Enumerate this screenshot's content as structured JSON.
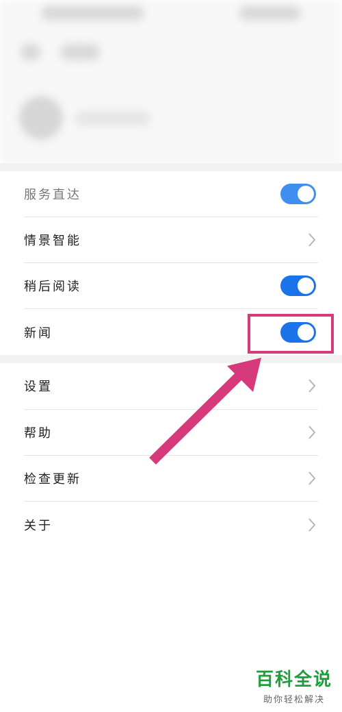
{
  "menu": {
    "items": [
      {
        "label": "服务直达",
        "control": "toggle",
        "state": "on"
      },
      {
        "label": "情景智能",
        "control": "chevron"
      },
      {
        "label": "稍后阅读",
        "control": "toggle",
        "state": "on"
      },
      {
        "label": "新闻",
        "control": "toggle",
        "state": "on",
        "highlighted": true
      },
      {
        "label": "设置",
        "control": "chevron"
      },
      {
        "label": "帮助",
        "control": "chevron"
      },
      {
        "label": "检查更新",
        "control": "chevron"
      },
      {
        "label": "关于",
        "control": "chevron"
      }
    ]
  },
  "colors": {
    "toggle_on": "#1a73e8",
    "highlight": "#d63a7a",
    "watermark": "#1e9e3a"
  },
  "icons": {
    "chevron": "chevron-right-icon",
    "arrow": "annotation-arrow-icon"
  },
  "watermark": {
    "title": "百科全说",
    "subtitle": "助你轻松解决"
  }
}
